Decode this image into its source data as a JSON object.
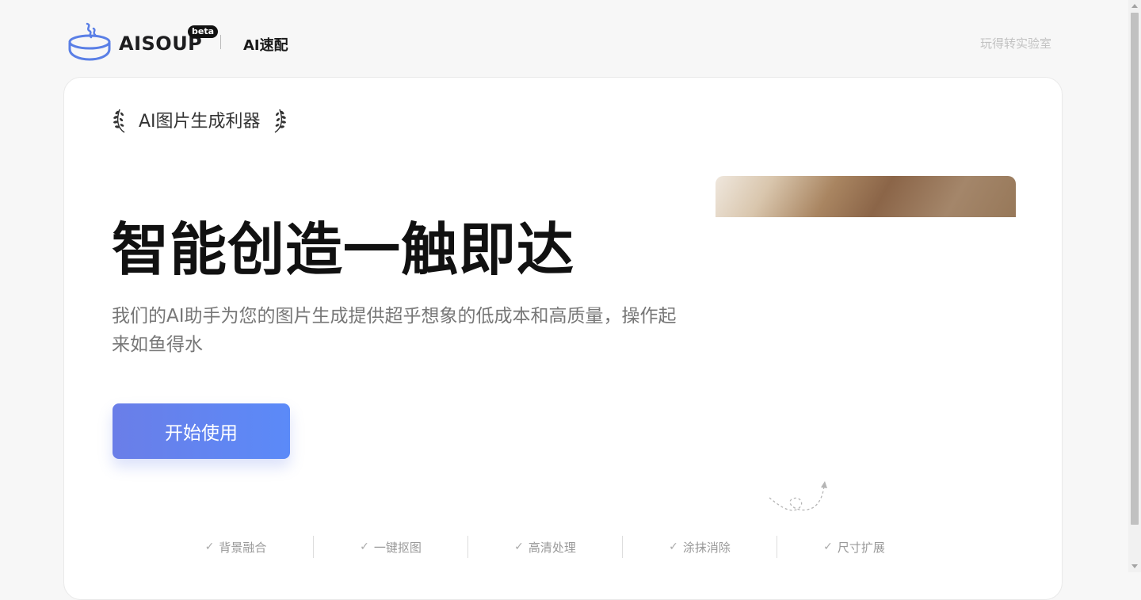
{
  "header": {
    "brand": "AISOUP",
    "beta": "beta",
    "product": "AI速配",
    "lab_link": "玩得转实验室"
  },
  "hero": {
    "award_text": "AI图片生成利器",
    "title": "智能创造一触即达",
    "description": "我们的AI助手为您的图片生成提供超乎想象的低成本和高质量，操作起来如鱼得水",
    "cta_label": "开始使用"
  },
  "features": [
    {
      "label": "背景融合"
    },
    {
      "label": "一键抠图"
    },
    {
      "label": "高清处理"
    },
    {
      "label": "涂抹消除"
    },
    {
      "label": "尺寸扩展"
    }
  ],
  "colors": {
    "accent": "#5b8af8",
    "logo_blue": "#5a7fe6"
  },
  "icons": {
    "logo": "soup-bowl-icon",
    "laurel": "laurel-icon",
    "check": "check-icon",
    "arrow": "curly-arrow-icon"
  }
}
